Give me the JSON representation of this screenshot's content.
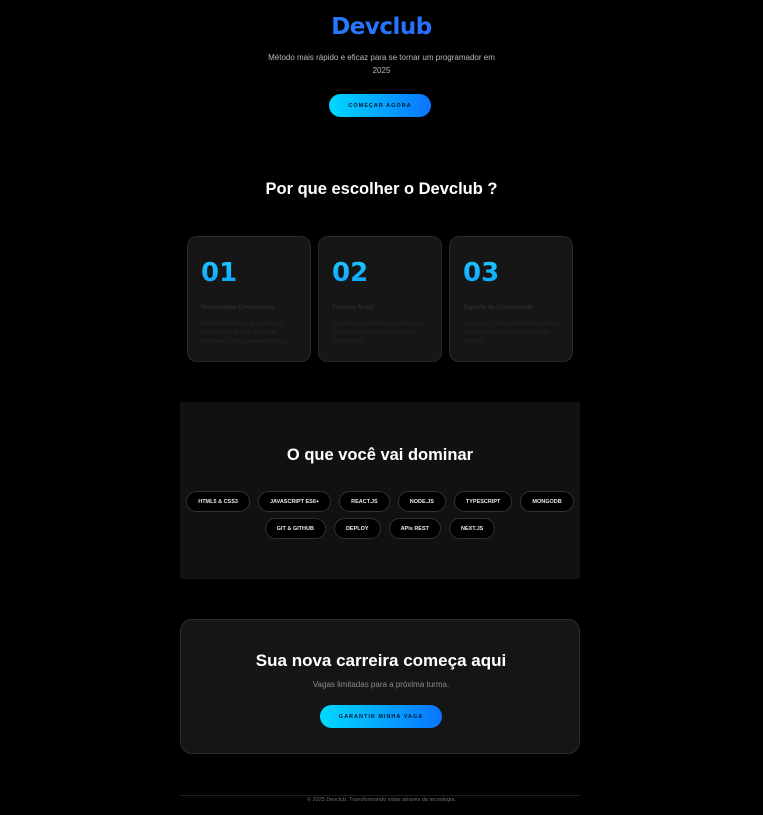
{
  "hero": {
    "brand": "Devclub",
    "subtitle": "Método mais rápido e eficaz para se tornar um programador em 2025",
    "cta_label": "COMEÇAR AGORA"
  },
  "why": {
    "title": "Por que escolher o Devclub ?",
    "cards": [
      {
        "number": "01",
        "title": "Metodologia Comprovada",
        "description": "Método testado e aprovado por milhares de alunos que hoje trabalham como programadores."
      },
      {
        "number": "02",
        "title": "Projetos Reais",
        "description": "Aprenda construindo projetos reais que vão compor o seu portfólio profissional."
      },
      {
        "number": "03",
        "title": "Suporte da Comunidade",
        "description": "Conte com uma comunidade ativa e mentores prontos para tirar suas dúvidas."
      }
    ]
  },
  "skills": {
    "title": "O que você vai dominar",
    "row1": [
      "HTML5 & CSS3",
      "JAVASCRIPT ES6+",
      "REACT.JS",
      "NODE.JS",
      "TYPESCRIPT",
      "MONGODB"
    ],
    "row2": [
      "GIT & GITHUB",
      "DEPLOY",
      "APIs REST",
      "NEXT.JS"
    ]
  },
  "cta": {
    "title": "Sua nova carreira começa aqui",
    "subtitle": "Vagas limitadas para a próxima turma.",
    "button_label": "GARANTIR MINHA VAGA"
  },
  "footer": {
    "text": "© 2025 Devclub. Transformando vidas através da tecnologia."
  },
  "colors": {
    "background": "#000000",
    "accent_start": "#00d9ff",
    "accent_end": "#0a74ff",
    "card_bg": "#161616"
  }
}
